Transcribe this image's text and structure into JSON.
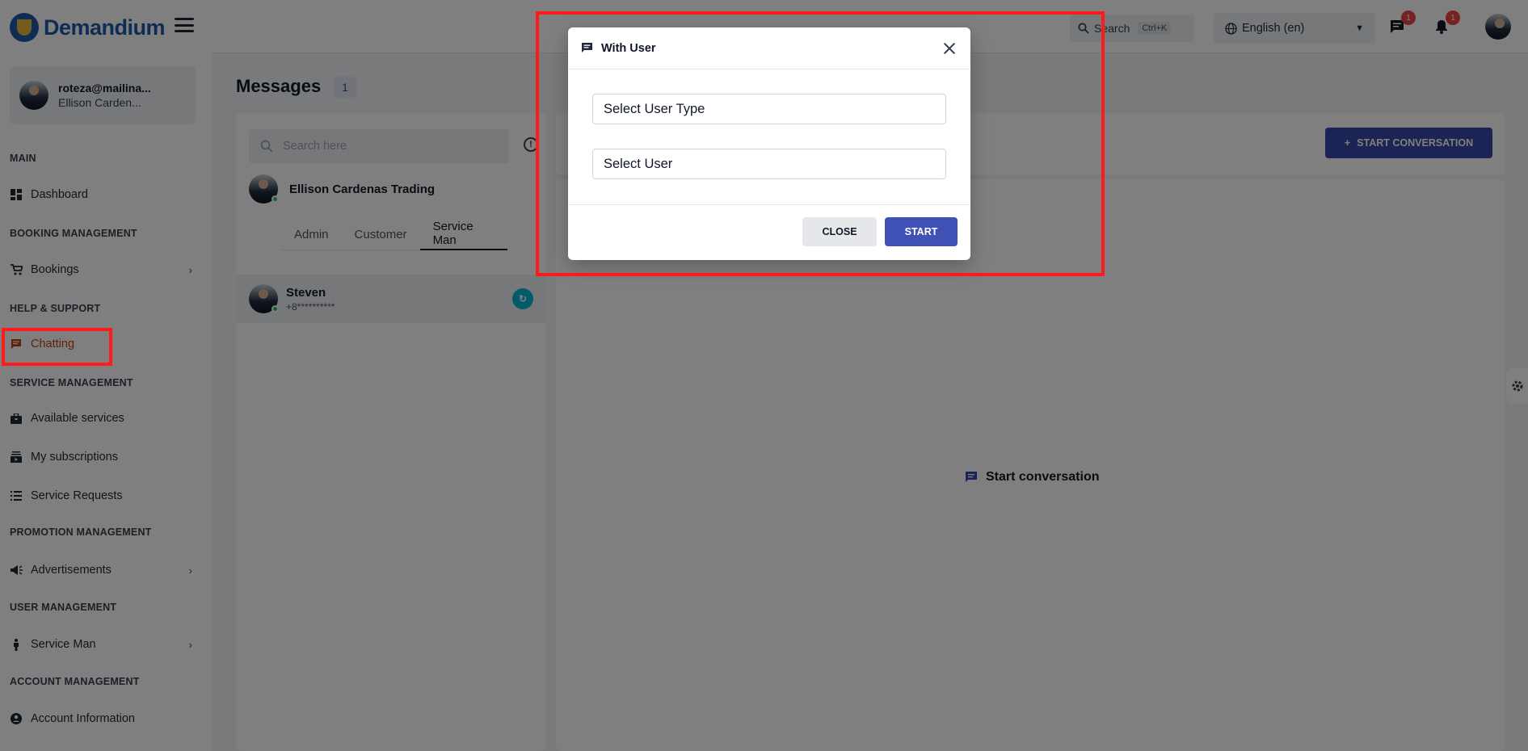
{
  "brand": {
    "name": "Demandium"
  },
  "profile": {
    "email": "roteza@mailina...",
    "name": "Ellison Carden..."
  },
  "sidebar": {
    "sections": [
      {
        "label": "MAIN"
      },
      {
        "label": "BOOKING MANAGEMENT"
      },
      {
        "label": "HELP & SUPPORT"
      },
      {
        "label": "SERVICE MANAGEMENT"
      },
      {
        "label": "PROMOTION MANAGEMENT"
      },
      {
        "label": "USER MANAGEMENT"
      },
      {
        "label": "ACCOUNT MANAGEMENT"
      }
    ],
    "items": [
      {
        "label": "Dashboard",
        "icon": "dashboard-icon"
      },
      {
        "label": "Bookings",
        "icon": "cart-icon",
        "has_children": true
      },
      {
        "label": "Chatting",
        "icon": "chat-icon",
        "active": true
      },
      {
        "label": "Available services",
        "icon": "briefcase-icon"
      },
      {
        "label": "My subscriptions",
        "icon": "subscriptions-icon"
      },
      {
        "label": "Service Requests",
        "icon": "list-icon"
      },
      {
        "label": "Advertisements",
        "icon": "megaphone-icon",
        "has_children": true
      },
      {
        "label": "Service Man",
        "icon": "person-icon",
        "has_children": true
      },
      {
        "label": "Account Information",
        "icon": "account-icon"
      }
    ]
  },
  "topbar": {
    "search_label": "Search",
    "search_shortcut": "Ctrl+K",
    "language": "English (en)",
    "messages_badge": "1",
    "notifications_badge": "1"
  },
  "main": {
    "title": "Messages",
    "count": "1",
    "search_placeholder": "Search here",
    "company_name": "Ellison Cardenas Trading",
    "tabs": [
      {
        "label": "Admin"
      },
      {
        "label": "Customer"
      },
      {
        "label": "Service Man",
        "active": true
      }
    ],
    "chat": {
      "name": "Steven",
      "phone": "+8**********"
    },
    "start_button": "START CONVERSATION",
    "empty_state": "Start conversation"
  },
  "modal": {
    "title": "With User",
    "user_type_placeholder": "Select User Type",
    "user_placeholder": "Select User",
    "close_label": "CLOSE",
    "start_label": "START"
  },
  "colors": {
    "brand": "#1e5aa8",
    "accent": "#3949ab",
    "active_nav": "#c2410c",
    "annotation": "#ff1a1a"
  }
}
